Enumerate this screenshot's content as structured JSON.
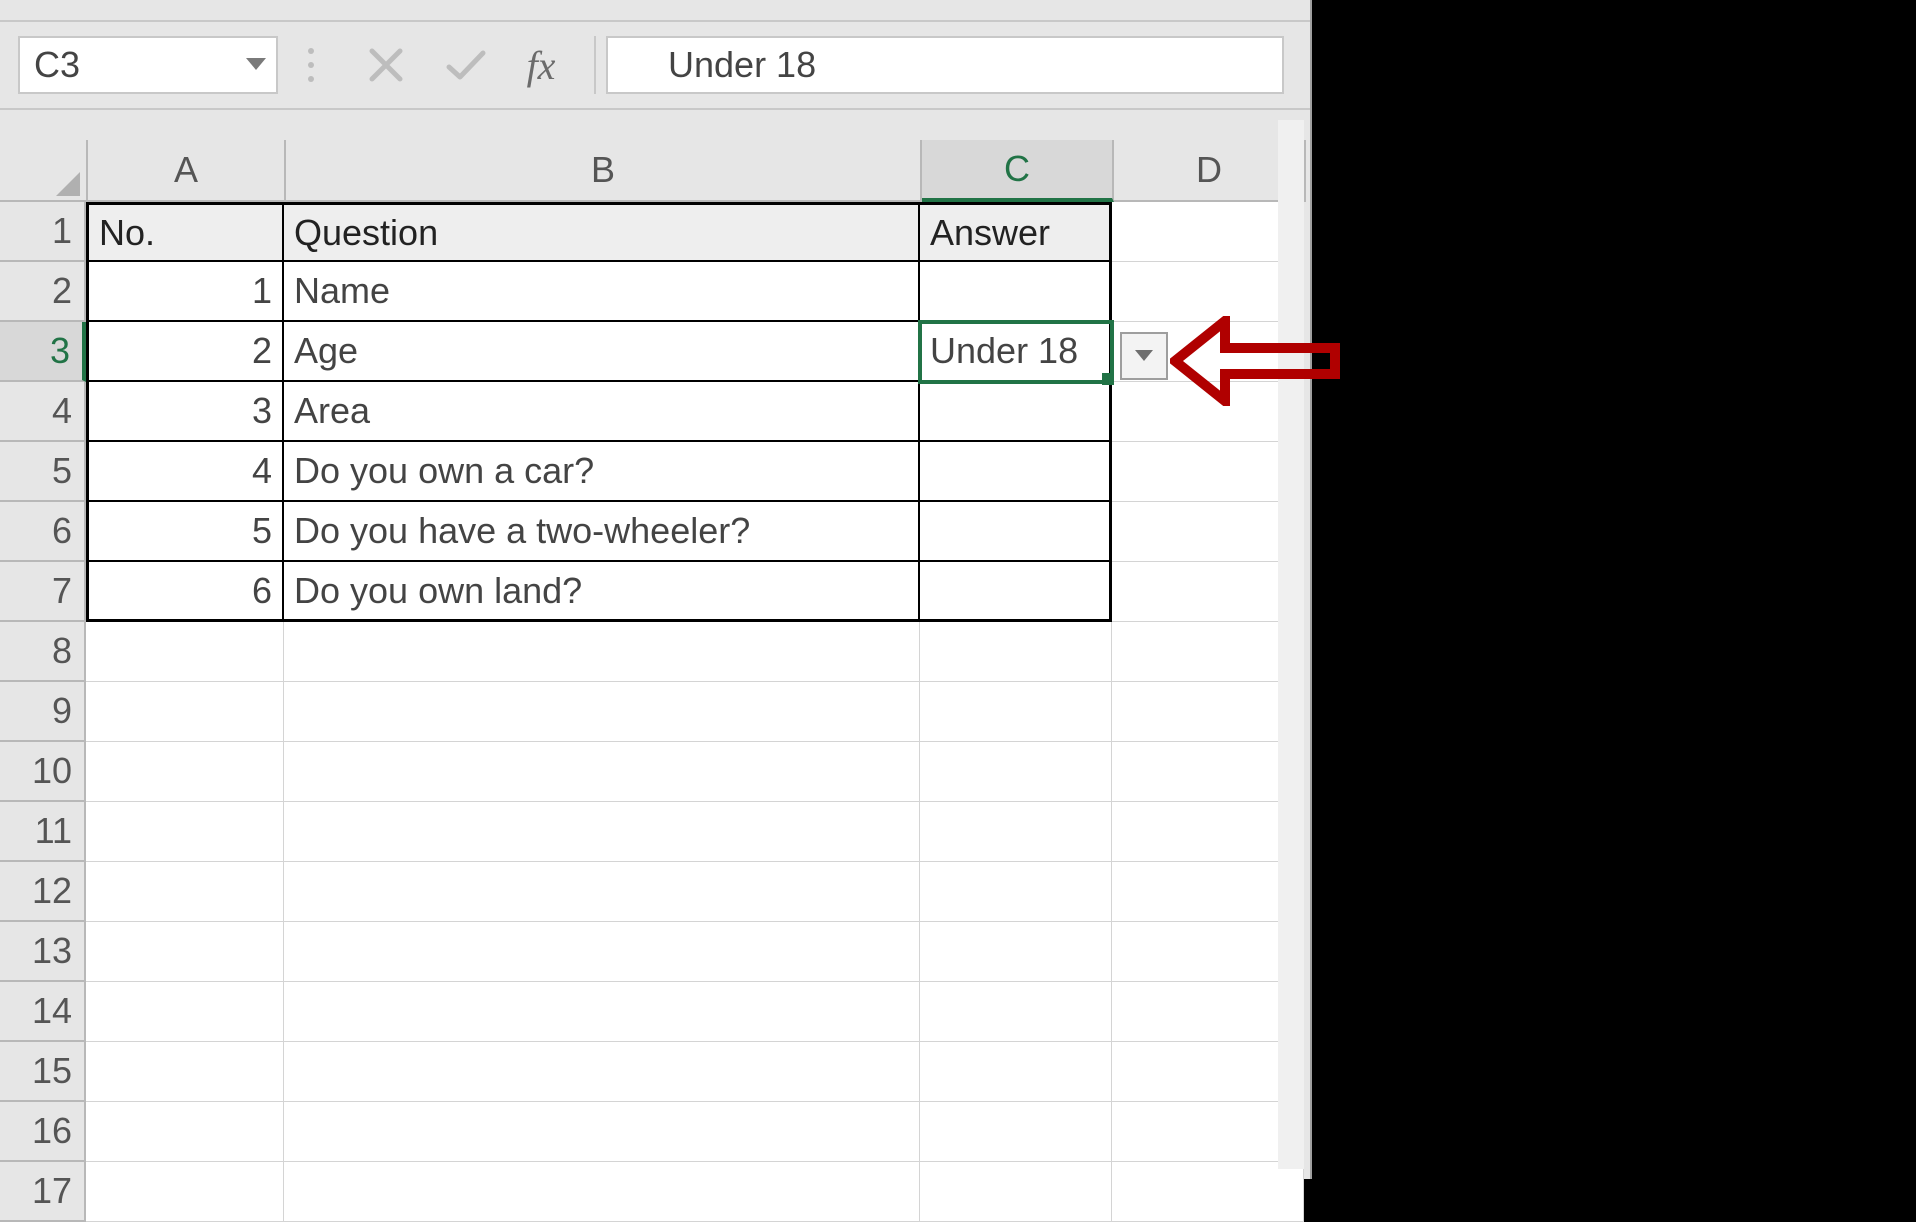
{
  "formula_bar": {
    "name_box": "C3",
    "fx_label": "fx",
    "formula_value": "Under 18"
  },
  "columns": {
    "A": "A",
    "B": "B",
    "C": "C",
    "D": "D"
  },
  "row_labels": [
    "1",
    "2",
    "3",
    "4",
    "5",
    "6",
    "7",
    "8",
    "9",
    "10",
    "11",
    "12",
    "13",
    "14",
    "15",
    "16",
    "17"
  ],
  "table": {
    "headers": {
      "no": "No.",
      "question": "Question",
      "answer": "Answer"
    },
    "rows": [
      {
        "no": "1",
        "question": "Name",
        "answer": ""
      },
      {
        "no": "2",
        "question": "Age",
        "answer": "Under 18"
      },
      {
        "no": "3",
        "question": "Area",
        "answer": ""
      },
      {
        "no": "4",
        "question": "Do you own a car?",
        "answer": ""
      },
      {
        "no": "5",
        "question": "Do you have a two-wheeler?",
        "answer": ""
      },
      {
        "no": "6",
        "question": "Do you own land?",
        "answer": ""
      }
    ]
  },
  "selection": {
    "cell": "C3"
  }
}
